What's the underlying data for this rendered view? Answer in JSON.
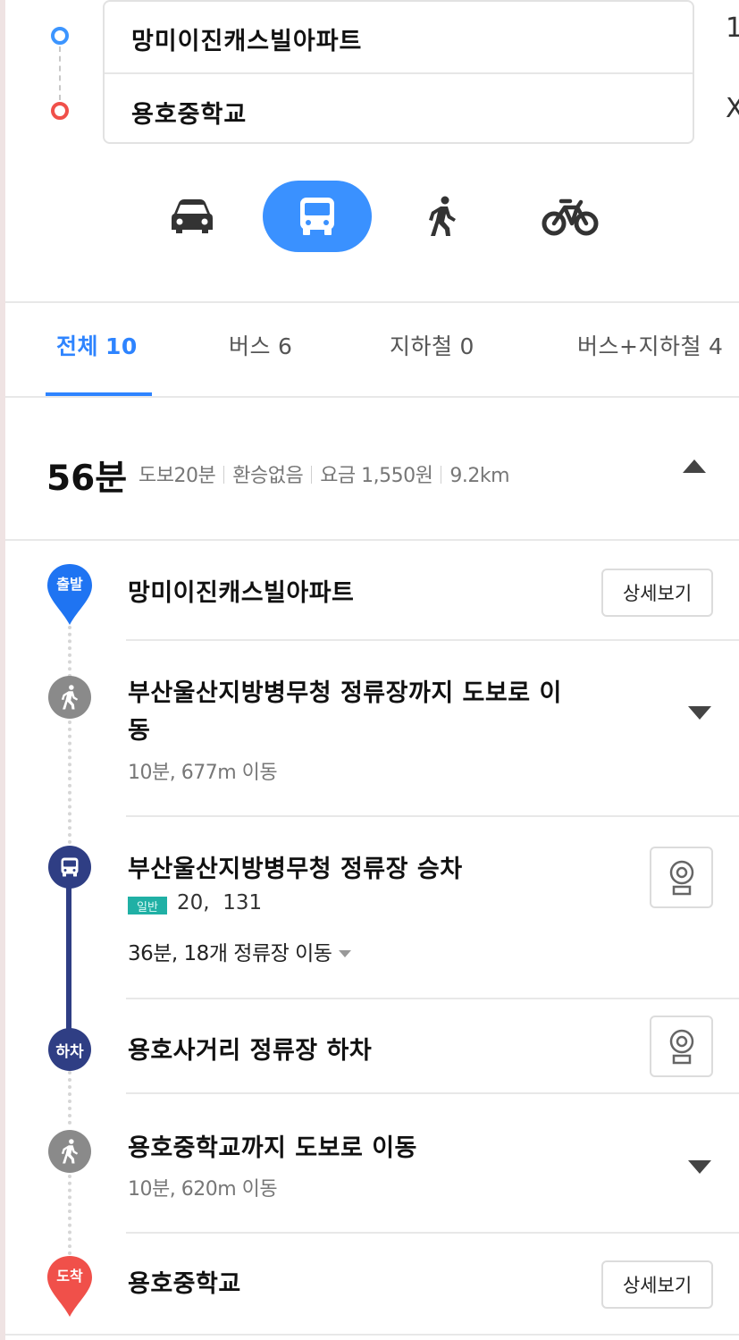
{
  "route": {
    "origin": "망미이진캐스빌아파트",
    "destination": "용호중학교",
    "side_top": "1",
    "side_bottom": "X"
  },
  "modes": [
    {
      "name": "car",
      "icon": "car-icon",
      "active": false
    },
    {
      "name": "bus",
      "icon": "bus-icon",
      "active": true
    },
    {
      "name": "walk",
      "icon": "walk-icon",
      "active": false
    },
    {
      "name": "bike",
      "icon": "bicycle-icon",
      "active": false
    }
  ],
  "tabs": [
    {
      "label": "전체",
      "count": "10",
      "active": true
    },
    {
      "label": "버스",
      "count": "6",
      "active": false
    },
    {
      "label": "지하철",
      "count": "0",
      "active": false
    },
    {
      "label": "버스+지하철",
      "count": "4",
      "active": false
    }
  ],
  "summary": {
    "time": "56분",
    "walk": "도보20분",
    "transfer": "환승없음",
    "fare": "요금 1,550원",
    "distance": "9.2km"
  },
  "steps": {
    "start": {
      "marker": "출발",
      "title": "망미이진캐스빌아파트",
      "button": "상세보기"
    },
    "walk1": {
      "title_line1": "부산울산지방병무청 정류장까지 도보로 이",
      "title_line2": "동",
      "sub": "10분, 677m 이동"
    },
    "board": {
      "title": "부산울산지방병무청 정류장 승차",
      "badge": "일반",
      "buses": "20,  131",
      "info": "36분, 18개 정류장 이동"
    },
    "alight": {
      "marker": "하차",
      "title": "용호사거리 정류장 하차"
    },
    "walk2": {
      "title": "용호중학교까지 도보로 이동",
      "sub": "10분, 620m 이동"
    },
    "end": {
      "marker": "도착",
      "title": "용호중학교",
      "button": "상세보기"
    }
  },
  "colors": {
    "accent": "#3a91ff",
    "origin": "#3c95ff",
    "destination": "#f0504a",
    "bus_line": "#2f3e84",
    "walk": "#8a8a8a",
    "badge": "#20b0a5"
  }
}
